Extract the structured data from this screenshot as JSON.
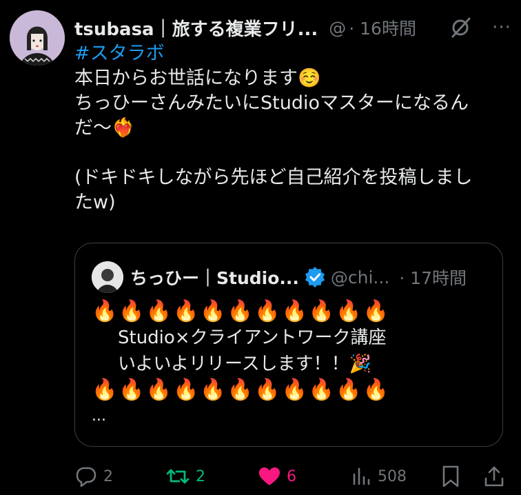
{
  "post": {
    "author_name": "tsubasa｜旅する複業フリ...",
    "handle": "@",
    "time": "· 16時間",
    "hashtag": "#スタラボ",
    "lines": [
      "本日からお世話になります☺️",
      "ちっひーさんみたいにStudioマスターになるん",
      "だ〜❤️‍🔥",
      "",
      "(ドキドキしながら先ほど自己紹介を投稿しまし",
      "たw)"
    ],
    "more": "···"
  },
  "quote": {
    "author_name": "ちっひー｜Studio...",
    "handle": "@chi...",
    "time": "· 17時間",
    "flames_top": "🔥🔥🔥🔥🔥🔥🔥🔥🔥🔥🔥",
    "line1": "Studio×クライアントワーク講座",
    "line2": "いよいよリリースします！！🎉",
    "flames_bottom": "🔥🔥🔥🔥🔥🔥🔥🔥🔥🔥🔥",
    "ellipsis": "..."
  },
  "actions": {
    "replies": "2",
    "reposts": "2",
    "likes": "6",
    "views": "508"
  },
  "colors": {
    "background": "#000000",
    "text": "#e7e9ea",
    "muted": "#71767b",
    "link": "#1d9bf0",
    "repost": "#00ba7c",
    "like": "#f91880",
    "verified": "#1d9bf0"
  },
  "icons": [
    "avatar",
    "grok-icon",
    "more-icon",
    "verified-badge-icon",
    "reply-icon",
    "repost-icon",
    "like-icon",
    "views-icon",
    "bookmark-icon",
    "share-icon"
  ]
}
